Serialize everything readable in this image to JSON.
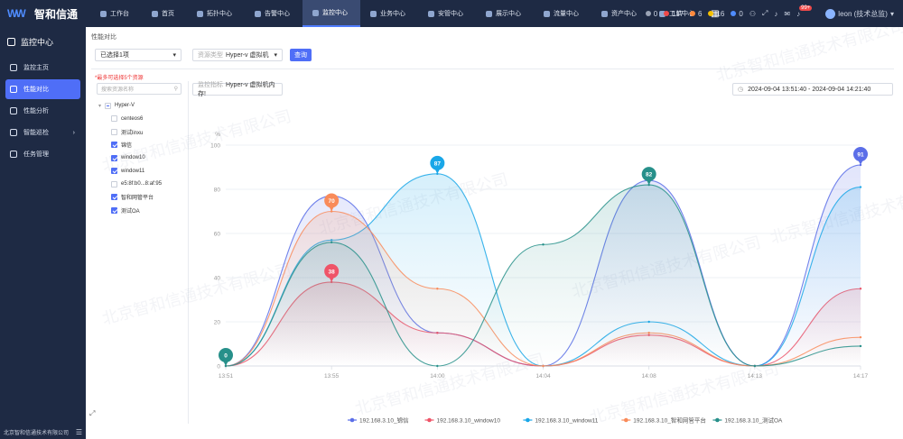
{
  "brand": {
    "name": "智和信通"
  },
  "nav": [
    {
      "label": "工作台"
    },
    {
      "label": "首页"
    },
    {
      "label": "拓扑中心"
    },
    {
      "label": "告警中心"
    },
    {
      "label": "监控中心",
      "active": true
    },
    {
      "label": "业务中心"
    },
    {
      "label": "安管中心"
    },
    {
      "label": "展示中心"
    },
    {
      "label": "流量中心"
    },
    {
      "label": "资产中心"
    },
    {
      "label": "工单中心"
    }
  ],
  "status": {
    "counts": [
      {
        "value": "0",
        "color": "#9aa3b5"
      },
      {
        "value": "117",
        "color": "#f04a4a"
      },
      {
        "value": "6",
        "color": "#ff8a3d"
      },
      {
        "value": "16",
        "color": "#f5c000"
      },
      {
        "value": "0",
        "color": "#4f8cff"
      }
    ],
    "notify_badge": "99+",
    "user": "leon (技术总监)"
  },
  "sidebar": {
    "title": "监控中心",
    "items": [
      {
        "label": "监控主页",
        "icon": "home-icon"
      },
      {
        "label": "性能对比",
        "icon": "compare-icon",
        "active": true
      },
      {
        "label": "性能分析",
        "icon": "analysis-icon"
      },
      {
        "label": "智能巡检",
        "icon": "inspect-icon"
      },
      {
        "label": "任务管理",
        "icon": "task-icon"
      }
    ],
    "footer": "北京智和信通技术有限公司"
  },
  "page": {
    "breadcrumb": "性能对比",
    "selected": "已选择1项",
    "resource_type_label": "资源类型",
    "resource_type": "Hyper-v 虚拟机",
    "query_button": "查询",
    "hint": "*最多可选择5个资源",
    "search_placeholder": "搜索资源名称",
    "metric_label": "监控指标",
    "metric": "Hyper-v 虚拟机内存!",
    "date_range": "2024-09-04 13:51:40  -  2024-09-04 14:21:40"
  },
  "tree": {
    "root": "Hyper-V",
    "children": [
      {
        "label": "centeos6",
        "checked": false
      },
      {
        "label": "测试linxu",
        "checked": false
      },
      {
        "label": "锦信",
        "checked": true
      },
      {
        "label": "window10",
        "checked": true
      },
      {
        "label": "window11",
        "checked": true
      },
      {
        "label": "e5:8f:b0...8:af:95",
        "checked": false
      },
      {
        "label": "智和网管平台",
        "checked": true
      },
      {
        "label": "测试OA",
        "checked": true
      }
    ]
  },
  "watermark": "北京智和信通技术有限公司",
  "chart_data": {
    "type": "line",
    "ylabel": "%",
    "ylim": [
      0,
      100
    ],
    "yticks": [
      0,
      20,
      40,
      60,
      80,
      100
    ],
    "categories": [
      "13:51",
      "13:55",
      "14:00",
      "14:04",
      "14:08",
      "14:13",
      "14:17"
    ],
    "legend_position": "bottom",
    "series": [
      {
        "name": "192.168.3.10_锦信",
        "color": "#5b6ee8",
        "values": [
          0,
          77,
          15,
          0,
          84,
          0,
          91
        ]
      },
      {
        "name": "192.168.3.10_window10",
        "color": "#ef5468",
        "values": [
          0,
          38,
          15,
          0,
          14,
          0,
          35
        ]
      },
      {
        "name": "192.168.3.10_window11",
        "color": "#1aa7e8",
        "values": [
          0,
          57,
          87,
          0,
          20,
          0,
          81
        ]
      },
      {
        "name": "192.168.3.10_智和网管平台",
        "color": "#f98b5a",
        "values": [
          0,
          70,
          35,
          0,
          15,
          0,
          13
        ]
      },
      {
        "name": "192.168.3.10_测试OA",
        "color": "#27908a",
        "values": [
          0,
          56,
          0,
          55,
          82,
          0,
          9
        ]
      }
    ],
    "markers": [
      {
        "label": "0",
        "series": 4,
        "index": 0
      },
      {
        "label": "70",
        "series": 3,
        "index": 1
      },
      {
        "label": "38",
        "series": 1,
        "index": 1
      },
      {
        "label": "87",
        "series": 2,
        "index": 2
      },
      {
        "label": "82",
        "series": 4,
        "index": 4
      },
      {
        "label": "91",
        "series": 0,
        "index": 6
      }
    ]
  }
}
